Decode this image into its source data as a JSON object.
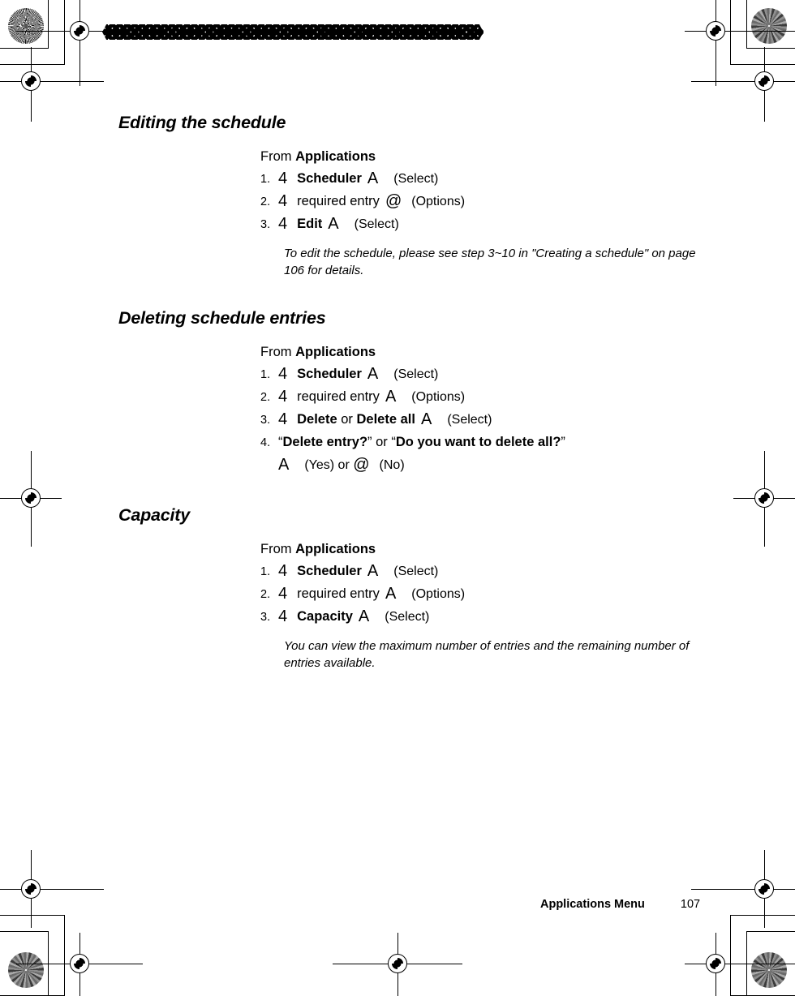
{
  "page": {
    "number": "107",
    "footer_label": "Applications Menu"
  },
  "glyphs": {
    "scroll_key": "4",
    "select_key": "A",
    "options_key": "@"
  },
  "sections": [
    {
      "id": "editing-the-schedule",
      "heading": "Editing the schedule",
      "from_prefix": "From ",
      "from_target": "Applications",
      "steps": [
        {
          "num": "1.",
          "key": "4",
          "label": "Scheduler",
          "label_bold": true,
          "action_key": "A",
          "action": "(Select)"
        },
        {
          "num": "2.",
          "key": "4",
          "label": "required entry",
          "label_bold": false,
          "action_key": "@",
          "action": "(Options)"
        },
        {
          "num": "3.",
          "key": "4",
          "label": "Edit",
          "label_bold": true,
          "action_key": "A",
          "action": "(Select)"
        }
      ],
      "note": "To edit the schedule, please see step 3~10 in \"Creating a schedule\" on page 106 for details."
    },
    {
      "id": "deleting-schedule-entries",
      "heading": "Deleting schedule entries",
      "from_prefix": "From ",
      "from_target": "Applications",
      "steps": [
        {
          "num": "1.",
          "key": "4",
          "label": "Scheduler",
          "label_bold": true,
          "action_key": "A",
          "action": "(Select)"
        },
        {
          "num": "2.",
          "key": "4",
          "label": "required entry",
          "label_bold": false,
          "action_key": "A",
          "action": "(Options)"
        },
        {
          "num": "3.",
          "key": "4",
          "label": "Delete",
          "label_bold": true,
          "label_conjunction": " or ",
          "label_alt": "Delete all",
          "action_key": "A",
          "action": "(Select)"
        }
      ],
      "prompt_step": {
        "num": "4.",
        "open_quote": "“",
        "prompt_a": "Delete entry?",
        "close_quote": "”",
        "conjunction": " or ",
        "prompt_b": "Do you want to delete all?",
        "yes_key": "A",
        "yes_label": "(Yes)",
        "or_label": " or ",
        "no_key": "@",
        "no_label": "(No)"
      },
      "note": ""
    },
    {
      "id": "capacity",
      "heading": "Capacity",
      "from_prefix": "From ",
      "from_target": "Applications",
      "steps": [
        {
          "num": "1.",
          "key": "4",
          "label": "Scheduler",
          "label_bold": true,
          "action_key": "A",
          "action": "(Select)"
        },
        {
          "num": "2.",
          "key": "4",
          "label": "required entry",
          "label_bold": false,
          "action_key": "A",
          "action": "(Options)"
        },
        {
          "num": "3.",
          "key": "4",
          "label": "Capacity",
          "label_bold": true,
          "action_key": "A",
          "action": "(Select)"
        }
      ],
      "note": "You can view the maximum number of entries and the remaining number of entries available."
    }
  ]
}
